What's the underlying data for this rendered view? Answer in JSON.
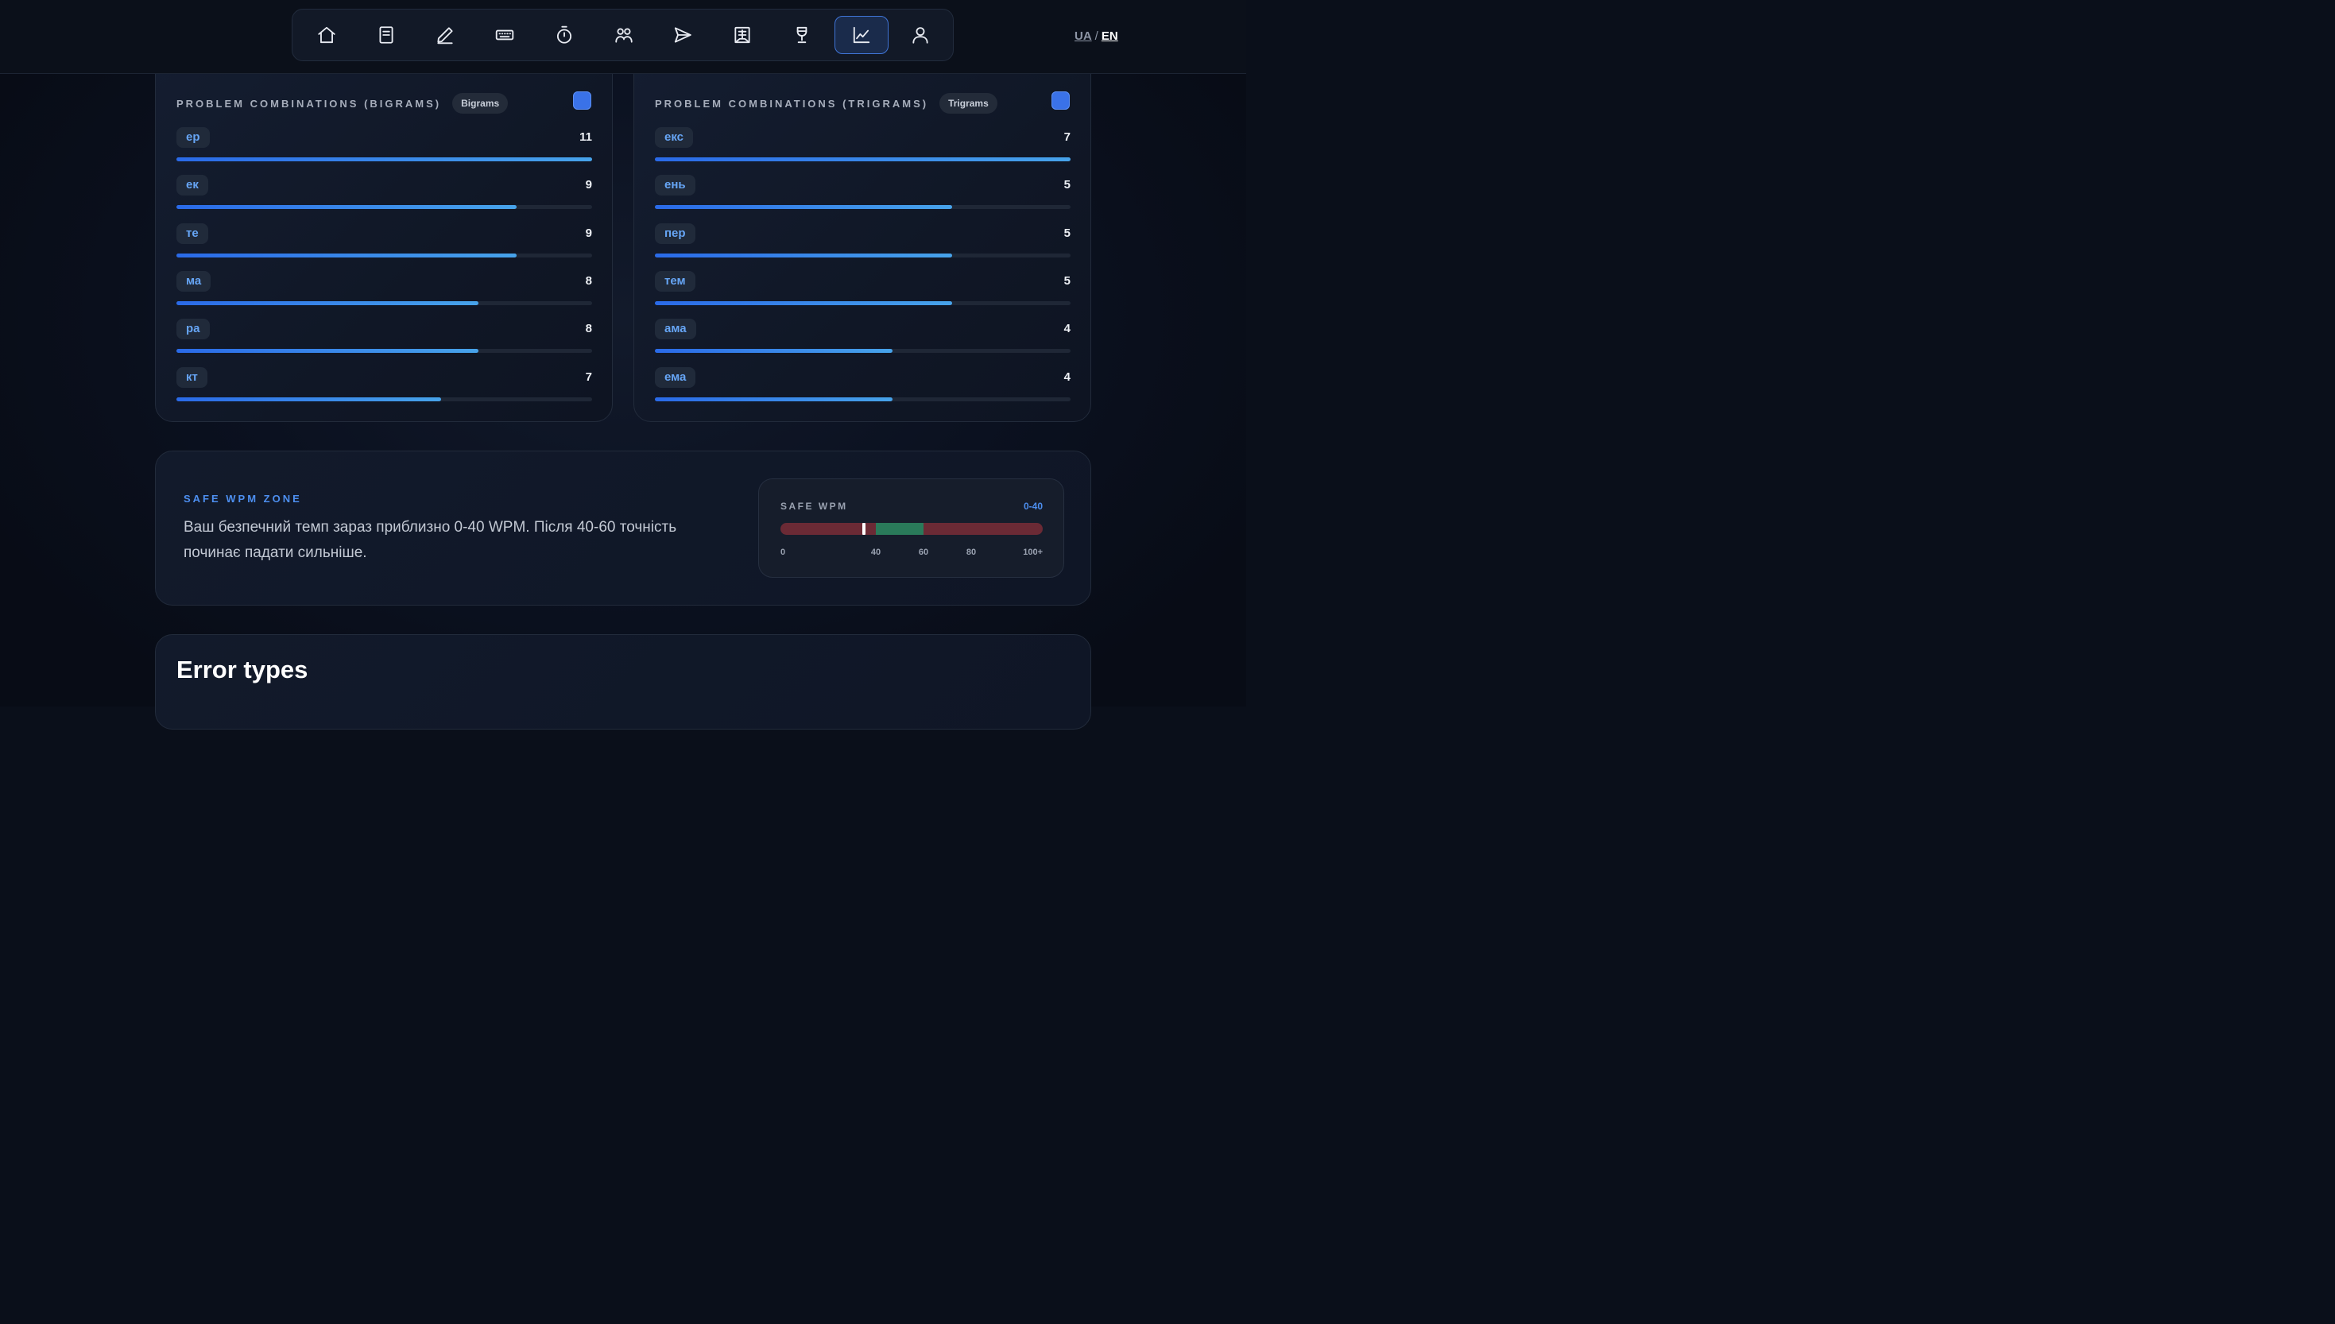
{
  "nav": {
    "items": [
      {
        "icon": "home-icon",
        "active": false
      },
      {
        "icon": "document-icon",
        "active": false
      },
      {
        "icon": "pencil-icon",
        "active": false
      },
      {
        "icon": "keyboard-icon",
        "active": false
      },
      {
        "icon": "timer-icon",
        "active": false
      },
      {
        "icon": "users-icon",
        "active": false
      },
      {
        "icon": "send-icon",
        "active": false
      },
      {
        "icon": "book-icon",
        "active": false
      },
      {
        "icon": "trophy-icon",
        "active": false
      },
      {
        "icon": "chart-icon",
        "active": true
      },
      {
        "icon": "user-icon",
        "active": false
      }
    ]
  },
  "lang": {
    "ua": "UA",
    "sep": "/",
    "en": "EN",
    "selected": "EN"
  },
  "bigrams": {
    "title": "PROBLEM COMBINATIONS (BIGRAMS)",
    "pill": "Bigrams",
    "max": 11,
    "rows": [
      {
        "label": "ер",
        "count": "11",
        "value": 11
      },
      {
        "label": "ек",
        "count": "9",
        "value": 9
      },
      {
        "label": "те",
        "count": "9",
        "value": 9
      },
      {
        "label": "ма",
        "count": "8",
        "value": 8
      },
      {
        "label": "ра",
        "count": "8",
        "value": 8
      },
      {
        "label": "кт",
        "count": "7",
        "value": 7
      }
    ]
  },
  "trigrams": {
    "title": "PROBLEM COMBINATIONS (TRIGRAMS)",
    "pill": "Trigrams",
    "max": 7,
    "rows": [
      {
        "label": "екс",
        "count": "7",
        "value": 7
      },
      {
        "label": "ень",
        "count": "5",
        "value": 5
      },
      {
        "label": "пер",
        "count": "5",
        "value": 5
      },
      {
        "label": "тем",
        "count": "5",
        "value": 5
      },
      {
        "label": "ама",
        "count": "4",
        "value": 4
      },
      {
        "label": "ема",
        "count": "4",
        "value": 4
      }
    ]
  },
  "safe": {
    "label": "SAFE WPM ZONE",
    "text": "Ваш безпечний темп зараз приблизно 0-40 WPM. Після 40-60 точність починає падати сильніше.",
    "gauge": {
      "title": "SAFE WPM",
      "range_label": "0-40",
      "scale_max": 110,
      "green_from": 40,
      "green_to": 60,
      "marker": 35,
      "ticks": [
        {
          "label": "0",
          "value": 0
        },
        {
          "label": "40",
          "value": 40
        },
        {
          "label": "60",
          "value": 60
        },
        {
          "label": "80",
          "value": 80
        },
        {
          "label": "100+",
          "value": 100
        }
      ]
    }
  },
  "errors": {
    "title": "Error types"
  },
  "colors": {
    "accent": "#3a72e8",
    "tag_text": "#66a5f5",
    "safe_zone": "#2a7a5a",
    "danger_zone": "#6b2a35"
  }
}
